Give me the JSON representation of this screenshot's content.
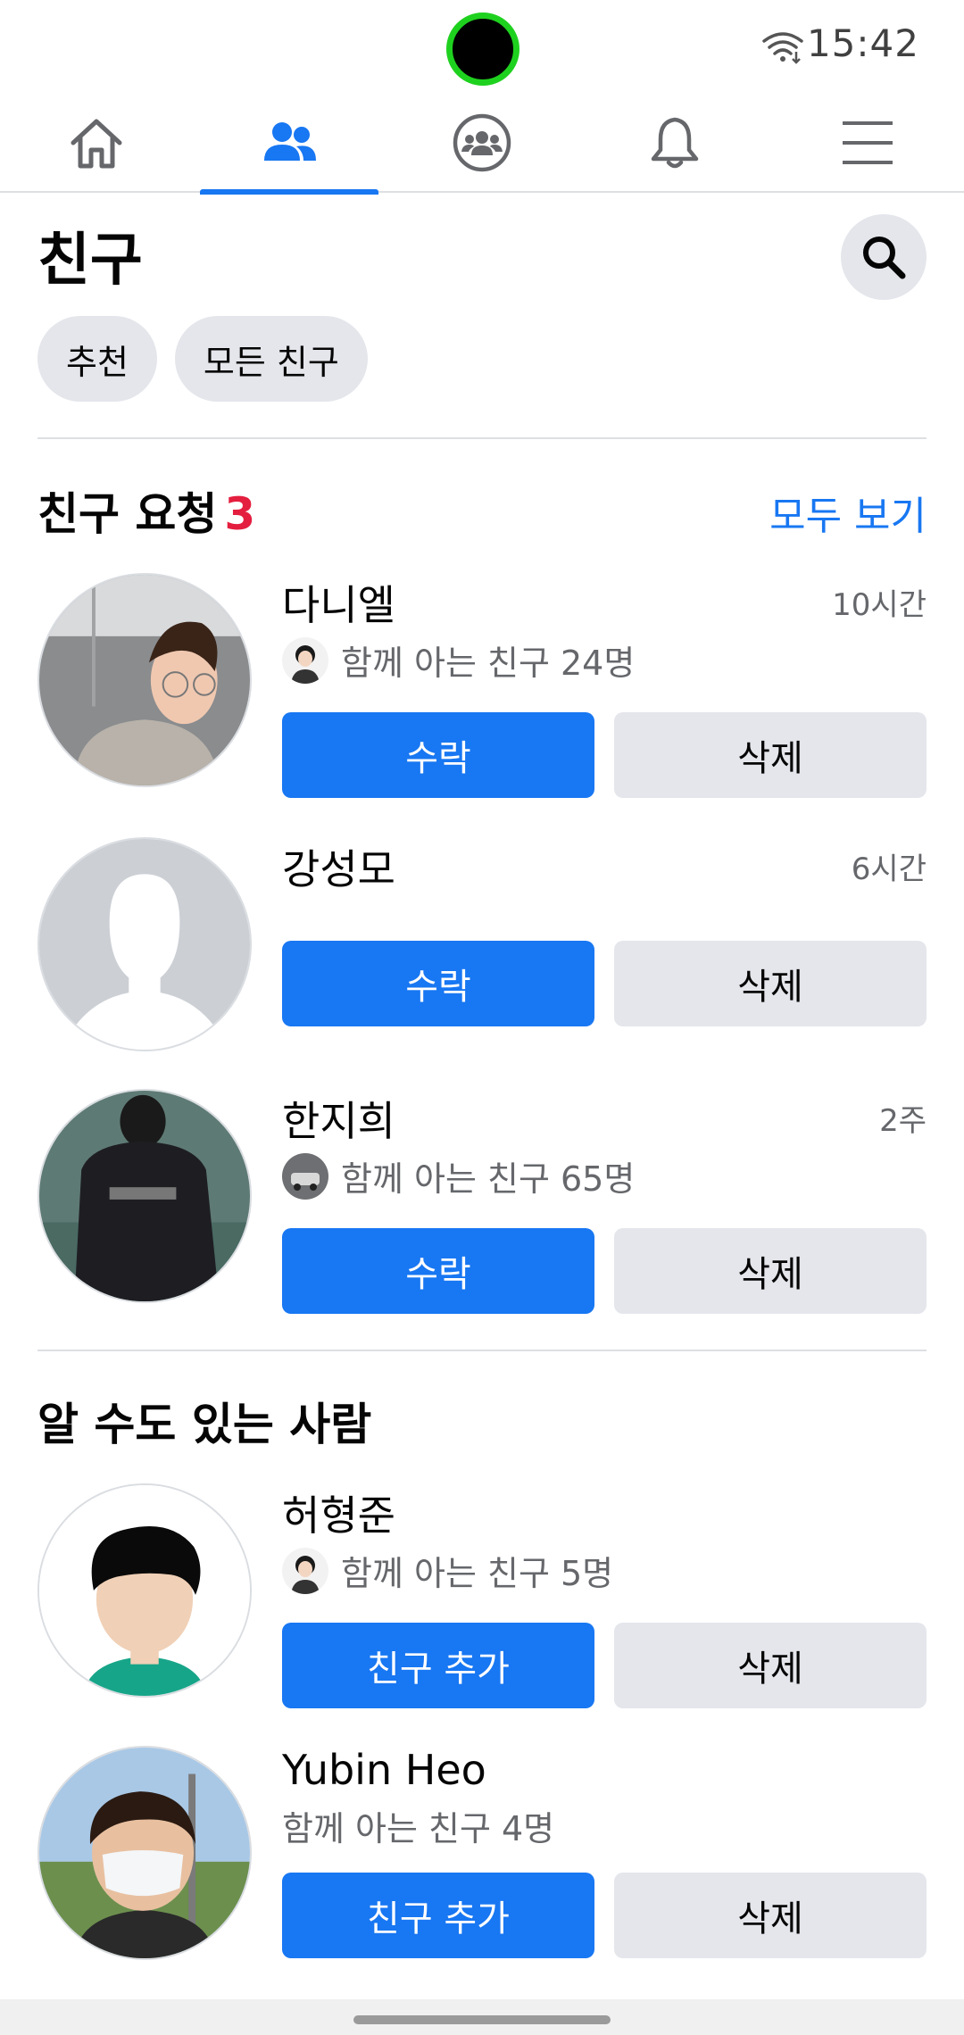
{
  "status_bar": {
    "time": "15:42",
    "wifi_icon": "wifi-icon"
  },
  "nav": {
    "tabs": [
      {
        "icon": "home-icon",
        "active": false
      },
      {
        "icon": "friends-icon",
        "active": true
      },
      {
        "icon": "groups-icon",
        "active": false
      },
      {
        "icon": "bell-icon",
        "active": false
      },
      {
        "icon": "menu-icon",
        "active": false
      }
    ]
  },
  "header": {
    "title": "친구",
    "search_icon": "search-icon"
  },
  "chips": [
    "추천",
    "모든 친구"
  ],
  "requests": {
    "title": "친구 요청",
    "count": "3",
    "see_all": "모두 보기",
    "items": [
      {
        "name": "다니엘",
        "time": "10시간",
        "mutual": "함께 아는 친구 24명",
        "accept": "수락",
        "delete": "삭제"
      },
      {
        "name": "강성모",
        "time": "6시간",
        "accept": "수락",
        "delete": "삭제"
      },
      {
        "name": "한지희",
        "time": "2주",
        "mutual": "함께 아는 친구 65명",
        "accept": "수락",
        "delete": "삭제"
      }
    ]
  },
  "suggestions": {
    "title": "알 수도 있는 사람",
    "items": [
      {
        "name": "허형준",
        "mutual": "함께 아는 친구 5명",
        "add": "친구 추가",
        "delete": "삭제"
      },
      {
        "name": "Yubin Heo",
        "mutual": "함께 아는 친구 4명",
        "add": "친구 추가",
        "delete": "삭제"
      }
    ]
  },
  "colors": {
    "accent": "#1877f2",
    "badge": "#e41e3f",
    "chip_bg": "#e4e6eb"
  }
}
